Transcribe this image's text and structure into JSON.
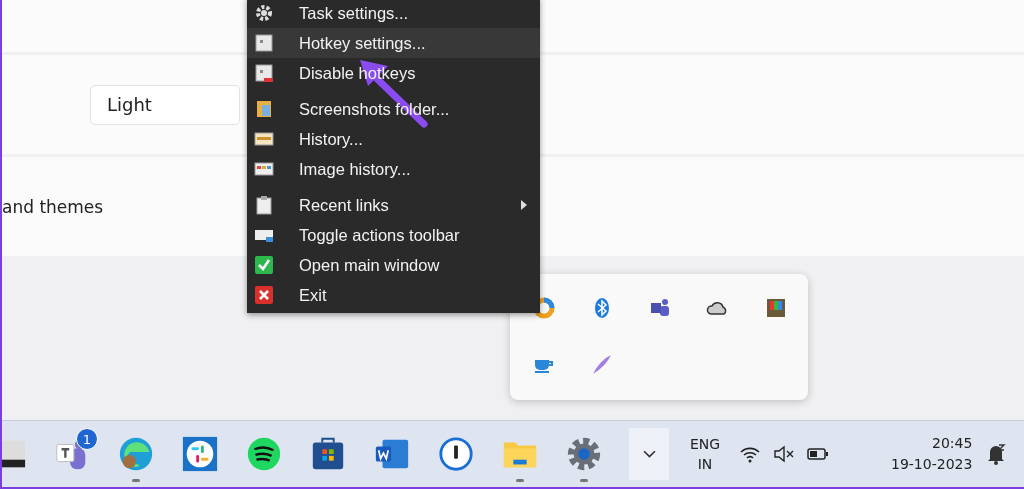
{
  "settings": {
    "theme_dropdown": {
      "value": "Light"
    },
    "row_label": "and themes"
  },
  "context_menu": {
    "items": [
      {
        "kind": "gear",
        "label": "Task settings...",
        "selected": false,
        "group_start": false,
        "submenu": false
      },
      {
        "kind": "hotkey",
        "label": "Hotkey settings...",
        "selected": true,
        "group_start": false,
        "submenu": false
      },
      {
        "kind": "hotkey-off",
        "label": "Disable hotkeys",
        "selected": false,
        "group_start": false,
        "submenu": false
      },
      {
        "kind": "folder",
        "label": "Screenshots folder...",
        "selected": false,
        "group_start": true,
        "submenu": false
      },
      {
        "kind": "history",
        "label": "History...",
        "selected": false,
        "group_start": false,
        "submenu": false
      },
      {
        "kind": "image-history",
        "label": "Image history...",
        "selected": false,
        "group_start": false,
        "submenu": false
      },
      {
        "kind": "clipboard",
        "label": "Recent links",
        "selected": false,
        "group_start": true,
        "submenu": true
      },
      {
        "kind": "toolbar",
        "label": "Toggle actions toolbar",
        "selected": false,
        "group_start": false,
        "submenu": false
      },
      {
        "kind": "check",
        "label": "Open main window",
        "selected": false,
        "group_start": false,
        "submenu": false
      },
      {
        "kind": "exit",
        "label": "Exit",
        "selected": false,
        "group_start": false,
        "submenu": false
      }
    ]
  },
  "taskbar": {
    "apps": [
      {
        "kind": "window",
        "running": false
      },
      {
        "kind": "chat",
        "running": false,
        "badge": "1"
      },
      {
        "kind": "browser",
        "running": true
      },
      {
        "kind": "hash",
        "running": false
      },
      {
        "kind": "music",
        "running": false
      },
      {
        "kind": "store",
        "running": false
      },
      {
        "kind": "document",
        "running": false
      },
      {
        "kind": "password",
        "running": false
      },
      {
        "kind": "folder",
        "running": true
      },
      {
        "kind": "gear",
        "running": true
      }
    ],
    "language": [
      "ENG",
      "IN"
    ],
    "clock": {
      "time": "20:45",
      "date": "19-10-2023"
    }
  }
}
